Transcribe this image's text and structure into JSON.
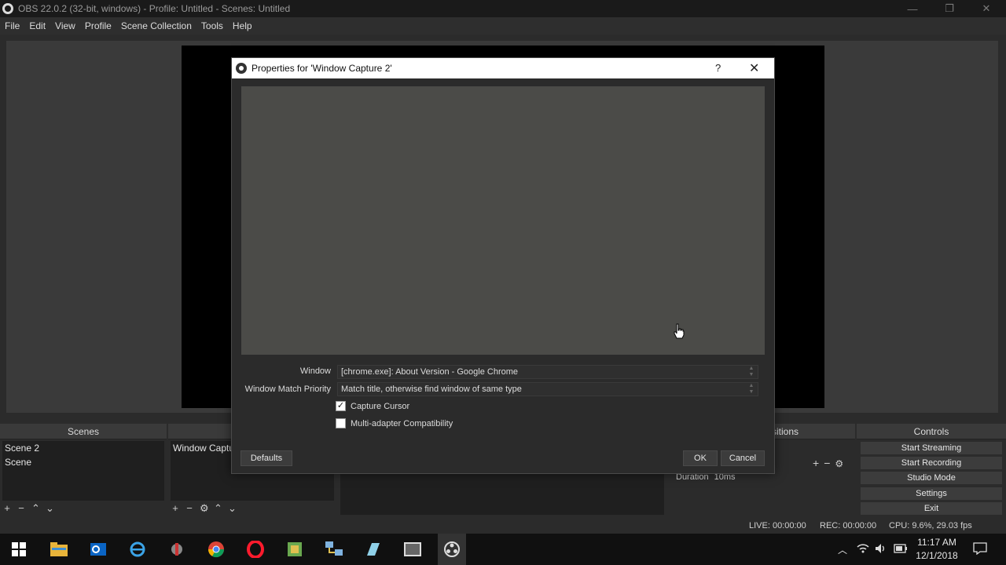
{
  "window": {
    "title": "OBS 22.0.2 (32-bit, windows) - Profile: Untitled - Scenes: Untitled",
    "minimize": "—",
    "restore": "❐",
    "close": "✕"
  },
  "menu": [
    "File",
    "Edit",
    "View",
    "Profile",
    "Scene Collection",
    "Tools",
    "Help"
  ],
  "dialog": {
    "title": "Properties for 'Window Capture 2'",
    "help": "?",
    "close": "✕",
    "window_label": "Window",
    "window_value": "[chrome.exe]: About Version - Google Chrome",
    "priority_label": "Window Match Priority",
    "priority_value": "Match title, otherwise find window of same type",
    "capture_cursor": {
      "label": "Capture Cursor",
      "checked": true
    },
    "multi_adapter": {
      "label": "Multi-adapter Compatibility",
      "checked": false
    },
    "defaults": "Defaults",
    "ok": "OK",
    "cancel": "Cancel"
  },
  "scenes": {
    "header": "Scenes",
    "items": [
      "Scene 2",
      "Scene"
    ]
  },
  "sources": {
    "items": [
      "Window Captur"
    ]
  },
  "transitions": {
    "header_partial": "sitions",
    "duration_label": "Duration",
    "duration_value": "10ms"
  },
  "controls": {
    "header": "Controls",
    "buttons": [
      "Start Streaming",
      "Start Recording",
      "Studio Mode",
      "Settings",
      "Exit"
    ]
  },
  "status": {
    "live": "LIVE: 00:00:00",
    "rec": "REC: 00:00:00",
    "cpu": "CPU: 9.6%, 29.03 fps"
  },
  "taskbar": {
    "time": "11:17 AM",
    "date": "12/1/2018"
  }
}
